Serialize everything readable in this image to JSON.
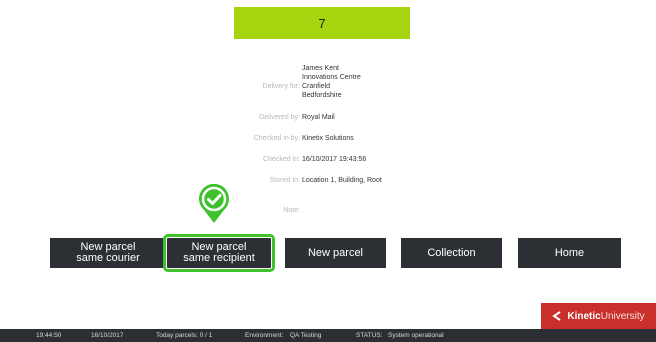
{
  "banner": {
    "value": "7"
  },
  "details": {
    "delivery_for_label": "Delivery for:",
    "delivery_for_lines": [
      "James Kent",
      "Innovations Centre",
      "Cranfield",
      "Bedfordshire"
    ],
    "delivered_by_label": "Delivered by:",
    "delivered_by": "Royal Mail",
    "checked_in_by_label": "Checked in by:",
    "checked_in_by": "Kinetix Solutions",
    "checked_in_label": "Checked in:",
    "checked_in": "16/10/2017 19:43:56",
    "stored_in_label": "Stored In:",
    "stored_in": "Location 1, Building, Root",
    "note_label": "Note:",
    "note": ""
  },
  "buttons": {
    "same_courier": [
      "New parcel",
      "same courier"
    ],
    "same_recipient": [
      "New parcel",
      "same recipient"
    ],
    "new_parcel": "New parcel",
    "collection": "Collection",
    "home": "Home"
  },
  "brand": {
    "bold": "Kinetic",
    "light": "University",
    "accent": "#c9302c"
  },
  "status_bar": {
    "time": "19:44:50",
    "date": "16/10/2017",
    "parcels": "Today parcels: 0 / 1",
    "environment_label": "Environment:",
    "environment": "QA Testing",
    "status_label": "STATUS:",
    "status": "System operational"
  },
  "colors": {
    "banner": "#a6d50f",
    "button": "#2c3035",
    "selection": "#3ec22b",
    "status_bar": "#2b2f33"
  },
  "icons": {
    "selected_marker": "check-pin-icon",
    "brand_logo": "kinetic-chevron-icon"
  }
}
